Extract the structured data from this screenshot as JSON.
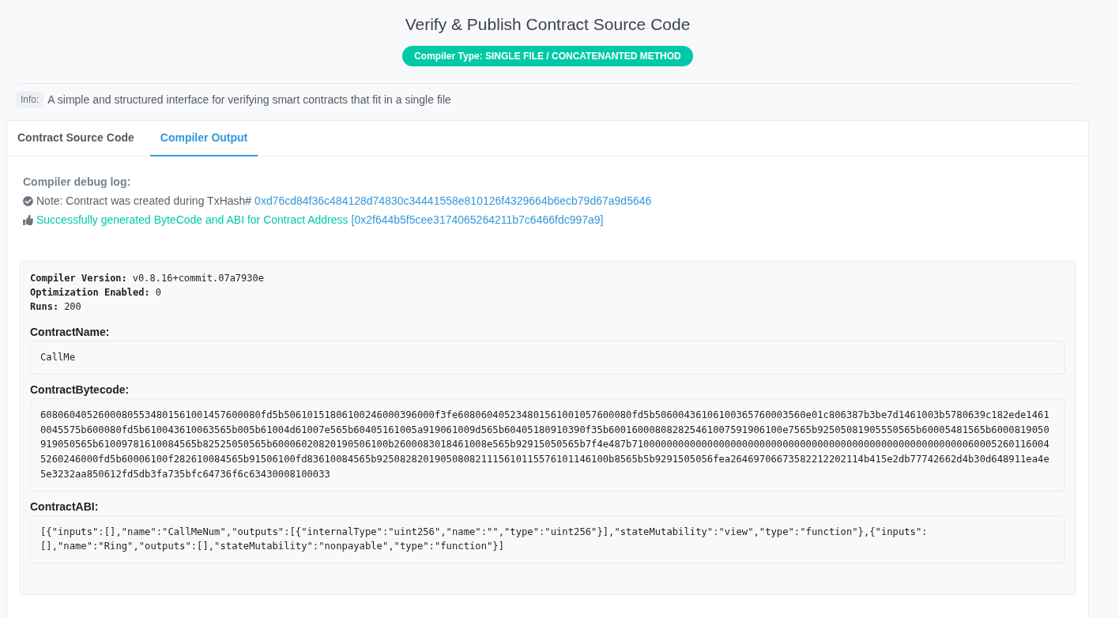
{
  "header": {
    "title": "Verify & Publish Contract Source Code",
    "badge": "Compiler Type: SINGLE FILE / CONCATENANTED METHOD"
  },
  "info": {
    "tag": "Info:",
    "text": "A simple and structured interface for verifying smart contracts that fit in a single file"
  },
  "tabs": [
    {
      "label": "Contract Source Code",
      "selected": false
    },
    {
      "label": "Compiler Output",
      "selected": true
    }
  ],
  "debug_log": {
    "heading": "Compiler debug log:",
    "entries": [
      {
        "kind": "note",
        "text": "Note: Contract was created during TxHash#",
        "link": "0xd76cd84f36c484128d74830c34441558e810126f4329664b6ecb79d67a9d5646"
      },
      {
        "kind": "success",
        "text": "Successfully generated ByteCode and ABI for Contract Address",
        "link": "[0x2f644b5f5cee3174065264211b7c6466fdc997a9]"
      }
    ]
  },
  "compiler_info": [
    {
      "label": "Compiler Version:",
      "value": "v0.8.16+commit.07a7930e"
    },
    {
      "label": "Optimization Enabled:",
      "value": "0"
    },
    {
      "label": "Runs:",
      "value": "200"
    }
  ],
  "fields": [
    {
      "label": "ContractName:",
      "value": "CallMe"
    },
    {
      "label": "ContractBytecode:",
      "value": "60806040526000805534801561001457600080fd5b50610151806100246000396000f3fe608060405234801561001057600080fd5b50600436106100365760003560e01c806387b3be7d1461003b5780639c182ede14610045575b600080fd5b610043610063565b005b61004d61007e565b60405161005a919061009d565b60405180910390f35b600160008082825461007591906100e7565b92505081905550565b60005481565b6000819050919050565b61009781610084565b82525050565b60006020820190506100b2600083018461008e565b92915050565b7f4e487b7100000000000000000000000000000000000000000000000000000000600052601160045260246000fd5b60006100f282610084565b91506100fd83610084565b9250828201905080821115610115576101146100b8565b5b9291505056fea26469706673582212202114b415e2db77742662d4b30d648911ea4e5e3232aa850612fd5db3fa735bfc64736f6c63430008100033"
    },
    {
      "label": "ContractABI:",
      "value": "[{\"inputs\":[],\"name\":\"CallMeNum\",\"outputs\":[{\"internalType\":\"uint256\",\"name\":\"\",\"type\":\"uint256\"}],\"stateMutability\":\"view\",\"type\":\"function\"},{\"inputs\":[],\"name\":\"Ring\",\"outputs\":[],\"stateMutability\":\"nonpayable\",\"type\":\"function\"}]"
    }
  ]
}
